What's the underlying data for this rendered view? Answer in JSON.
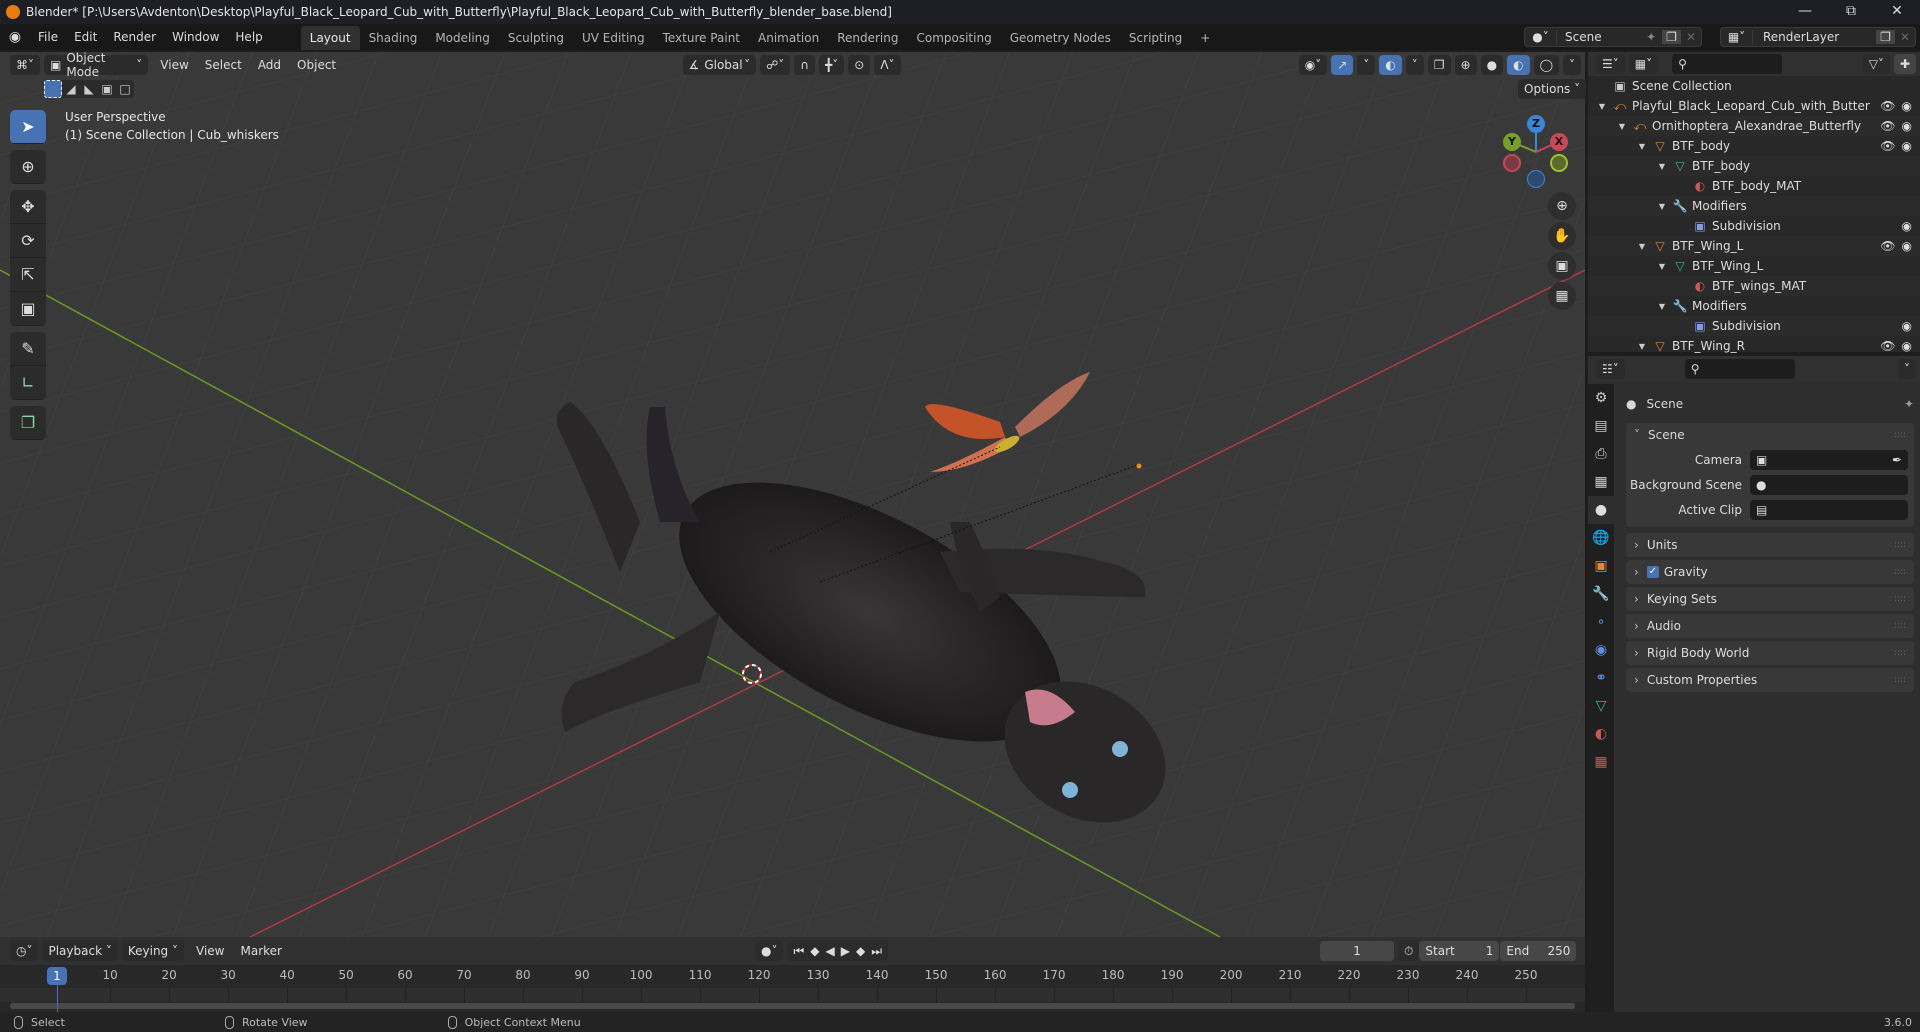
{
  "window": {
    "title": "Blender* [P:\\Users\\Avdenton\\Desktop\\Playful_Black_Leopard_Cub_with_Butterfly\\Playful_Black_Leopard_Cub_with_Butterfly_blender_base.blend]",
    "controls": [
      "minimize",
      "maximize",
      "close"
    ]
  },
  "menubar": {
    "items": [
      "File",
      "Edit",
      "Render",
      "Window",
      "Help"
    ],
    "workspaces": [
      "Layout",
      "Shading",
      "Modeling",
      "Sculpting",
      "UV Editing",
      "Texture Paint",
      "Animation",
      "Rendering",
      "Compositing",
      "Geometry Nodes",
      "Scripting"
    ],
    "active_workspace": "Layout",
    "add_workspace": "+",
    "scene": "Scene",
    "view_layer": "RenderLayer"
  },
  "viewport": {
    "mode": "Object Mode",
    "menus": [
      "View",
      "Select",
      "Add",
      "Object"
    ],
    "transform_orientation": "Global",
    "options_label": "Options",
    "perspective_label": "User Perspective",
    "context_label": "(1) Scene Collection | Cub_whiskers",
    "gizmo_axes": [
      "Z",
      "Y",
      "X"
    ],
    "colors": {
      "x_axis": "#c94857",
      "y_axis": "#7a9e2a",
      "z_axis": "#3b84d6",
      "accent": "#4772b3"
    }
  },
  "outliner": {
    "root": "Scene Collection",
    "rows": [
      {
        "label": "Playful_Black_Leopard_Cub_with_Butter",
        "icon": "empty-icon",
        "depth": 0,
        "expanded": true,
        "eye": true,
        "camera": true
      },
      {
        "label": "Ornithoptera_Alexandrae_Butterfly",
        "icon": "empty-icon",
        "depth": 1,
        "expanded": true,
        "eye": true,
        "camera": true
      },
      {
        "label": "BTF_body",
        "icon": "mesh-object-icon",
        "depth": 2,
        "expanded": true,
        "eye": true,
        "camera": true
      },
      {
        "label": "BTF_body",
        "icon": "mesh-data-icon",
        "depth": 3,
        "expanded": true,
        "eye": false,
        "camera": false
      },
      {
        "label": "BTF_body_MAT",
        "icon": "material-icon",
        "depth": 4,
        "expanded": null,
        "eye": false,
        "camera": false
      },
      {
        "label": "Modifiers",
        "icon": "wrench-icon",
        "depth": 3,
        "expanded": true,
        "eye": false,
        "camera": false
      },
      {
        "label": "Subdivision",
        "icon": "subdivision-icon",
        "depth": 4,
        "expanded": null,
        "eye": false,
        "camera": true
      },
      {
        "label": "BTF_Wing_L",
        "icon": "mesh-object-icon",
        "depth": 2,
        "expanded": true,
        "eye": true,
        "camera": true
      },
      {
        "label": "BTF_Wing_L",
        "icon": "mesh-data-icon",
        "depth": 3,
        "expanded": true,
        "eye": false,
        "camera": false
      },
      {
        "label": "BTF_wings_MAT",
        "icon": "material-icon",
        "depth": 4,
        "expanded": null,
        "eye": false,
        "camera": false
      },
      {
        "label": "Modifiers",
        "icon": "wrench-icon",
        "depth": 3,
        "expanded": true,
        "eye": false,
        "camera": false
      },
      {
        "label": "Subdivision",
        "icon": "subdivision-icon",
        "depth": 4,
        "expanded": null,
        "eye": false,
        "camera": true
      },
      {
        "label": "BTF_Wing_R",
        "icon": "mesh-object-icon",
        "depth": 2,
        "expanded": true,
        "eye": true,
        "camera": true
      }
    ]
  },
  "properties": {
    "context": "Scene",
    "scene_panel": {
      "title": "Scene",
      "fields": [
        {
          "label": "Camera",
          "value": ""
        },
        {
          "label": "Background Scene",
          "value": ""
        },
        {
          "label": "Active Clip",
          "value": ""
        }
      ]
    },
    "panels": [
      {
        "label": "Units",
        "checkbox": null
      },
      {
        "label": "Gravity",
        "checkbox": true
      },
      {
        "label": "Keying Sets",
        "checkbox": null
      },
      {
        "label": "Audio",
        "checkbox": null
      },
      {
        "label": "Rigid Body World",
        "checkbox": null
      },
      {
        "label": "Custom Properties",
        "checkbox": null
      }
    ],
    "tabs": [
      "tool",
      "render",
      "output",
      "view-layer",
      "scene",
      "world",
      "object",
      "modifiers",
      "particles",
      "physics",
      "constraints",
      "data",
      "material",
      "texture"
    ],
    "active_tab": "scene"
  },
  "timeline": {
    "menus": [
      "Playback",
      "Keying",
      "View",
      "Marker"
    ],
    "current_frame": "1",
    "start_label": "Start",
    "start": "1",
    "end_label": "End",
    "end": "250",
    "ticks": [
      "10",
      "20",
      "30",
      "40",
      "50",
      "60",
      "70",
      "80",
      "90",
      "100",
      "110",
      "120",
      "130",
      "140",
      "150",
      "160",
      "170",
      "180",
      "190",
      "200",
      "210",
      "220",
      "230",
      "240",
      "250"
    ],
    "playhead": "1"
  },
  "statusbar": {
    "items": [
      "Select",
      "Rotate View",
      "Object Context Menu"
    ],
    "version": "3.6.0"
  }
}
